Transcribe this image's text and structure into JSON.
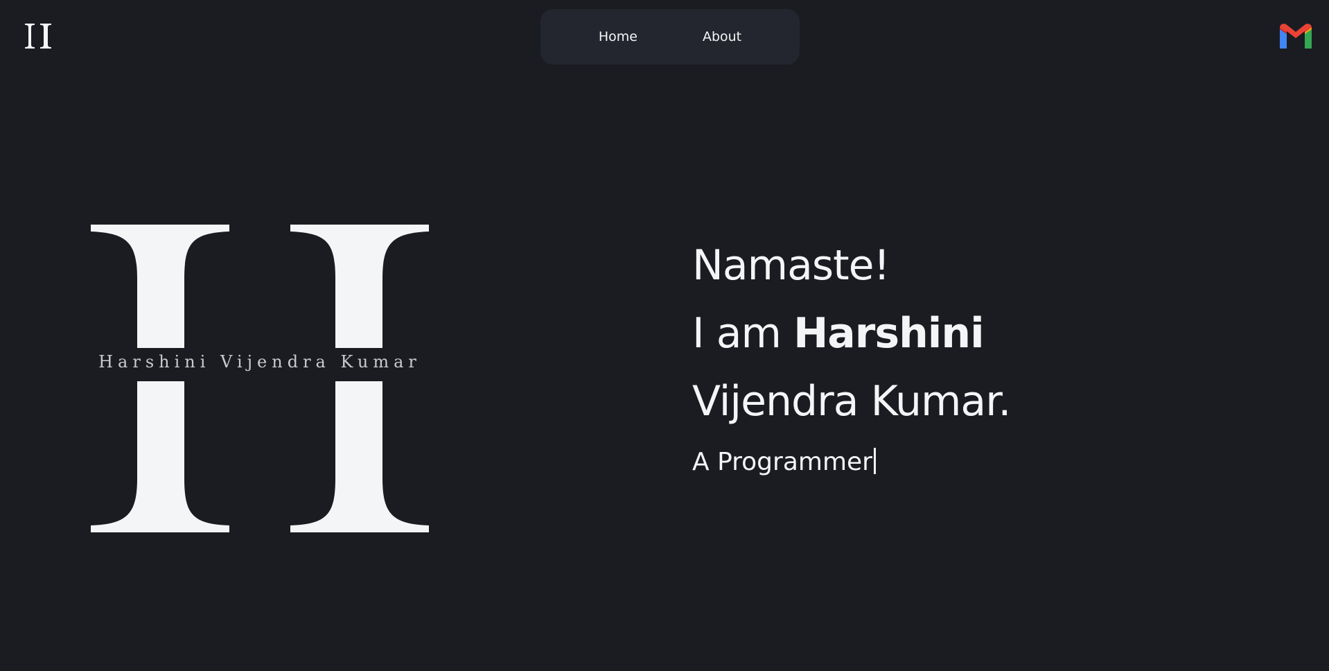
{
  "nav": {
    "items": [
      {
        "label": "Home"
      },
      {
        "label": "About"
      }
    ]
  },
  "logo": {
    "caption": "Harshini Vijendra Kumar"
  },
  "hero": {
    "greeting": "Namaste!",
    "intro_prefix": "I am ",
    "first_name": "Harshini",
    "last_name_line": "Vijendra Kumar.",
    "tagline": "A Programmer"
  },
  "icons": {
    "corner_logo": "monogram-icon",
    "mail": "gmail-icon"
  },
  "colors": {
    "background": "#1a1c21",
    "nav_background": "#23262e",
    "text": "#f4f5f7"
  }
}
